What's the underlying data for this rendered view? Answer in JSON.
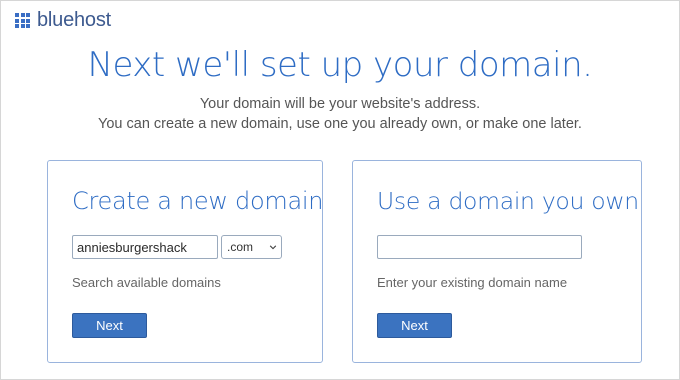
{
  "brand": {
    "name": "bluehost",
    "icon": "grid-logo-icon",
    "color": "#3a6ec4"
  },
  "headline": "Next we'll set up your domain.",
  "subtitle": {
    "line1": "Your domain will be your website's address.",
    "line2": "You can create a new domain, use one you already own, or make one later."
  },
  "create_card": {
    "title": "Create a new domain",
    "domain_value": "anniesburgershack",
    "tld_selected": ".com",
    "hint": "Search available domains",
    "next_label": "Next"
  },
  "own_card": {
    "title": "Use a domain you own",
    "domain_value": "",
    "hint": "Enter your existing domain name",
    "next_label": "Next"
  },
  "colors": {
    "accent": "#2e6cc4",
    "button": "#3b73c0",
    "card_border": "#9ab4dd"
  }
}
